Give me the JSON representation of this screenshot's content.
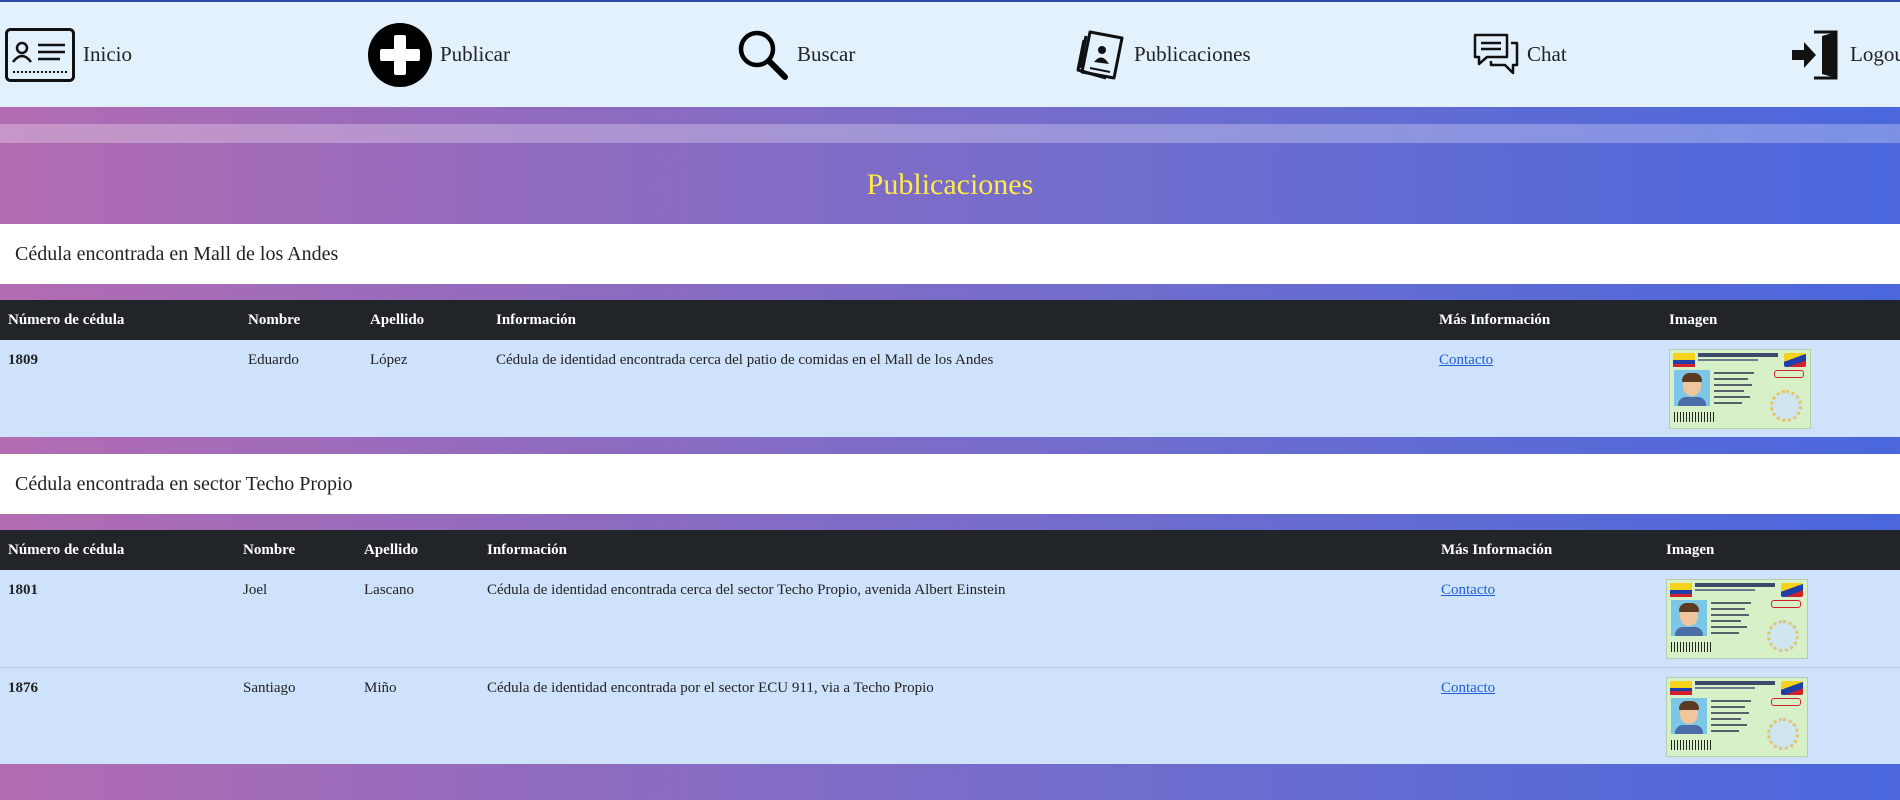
{
  "nav": {
    "inicio": "Inicio",
    "publicar": "Publicar",
    "buscar": "Buscar",
    "publicaciones": "Publicaciones",
    "chat": "Chat",
    "logout": "Logout"
  },
  "page_title": "Publicaciones",
  "columns": {
    "numero": "Número de cédula",
    "nombre": "Nombre",
    "apellido": "Apellido",
    "informacion": "Información",
    "mas_info": "Más Información",
    "imagen": "Imagen"
  },
  "posts": [
    {
      "title": "Cédula encontrada en Mall de los Andes",
      "rows": [
        {
          "numero": "1809",
          "nombre": "Eduardo",
          "apellido": "López",
          "informacion": "Cédula de identidad encontrada cerca del patio de comidas en el Mall de los Andes",
          "mas_info": "Contacto"
        }
      ]
    },
    {
      "title": "Cédula encontrada en sector Techo Propio",
      "rows": [
        {
          "numero": "1801",
          "nombre": "Joel",
          "apellido": "Lascano",
          "informacion": "Cédula de identidad encontrada cerca del sector Techo Propio, avenida Albert Einstein",
          "mas_info": "Contacto"
        },
        {
          "numero": "1876",
          "nombre": "Santiago",
          "apellido": "Miño",
          "informacion": "Cédula de identidad encontrada por el sector ECU 911, via a Techo Propio",
          "mas_info": "Contacto"
        }
      ]
    }
  ],
  "colors": {
    "title_yellow": "#ffea4a",
    "table_header": "#212529",
    "row_bg": "#cfe2fc",
    "navbar_bg": "#e3f1fd",
    "link": "#1f5fd6"
  },
  "icons": {
    "inicio": "id-card-icon",
    "publicar": "plus-circle-icon",
    "buscar": "search-icon",
    "publicaciones": "newspaper-icon",
    "chat": "chat-bubbles-icon",
    "logout": "door-exit-icon",
    "row_image": "id-card-image"
  }
}
